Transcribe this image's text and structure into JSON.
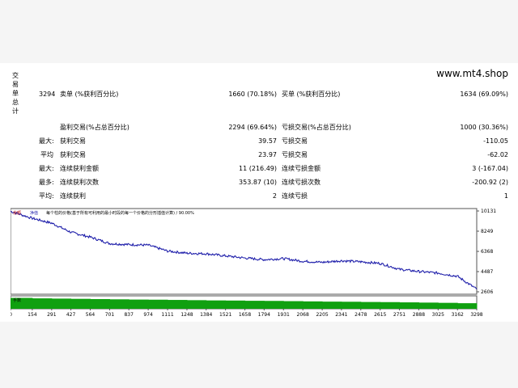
{
  "vertical_label": [
    "交",
    "易",
    "单",
    "总",
    "计"
  ],
  "site": "www.mt4.shop",
  "stats": {
    "total_trades": "3294",
    "short_label": "卖单 (%获利百分比)",
    "short_value": "1660 (70.18%)",
    "long_label": "买单 (%获利百分比)",
    "long_value": "1634 (69.09%)",
    "profit_trades_label": "盈利交易(%占总百分比)",
    "profit_trades_value": "2294 (69.64%)",
    "loss_trades_label": "亏损交易(%占总百分比)",
    "loss_trades_value": "1000 (30.36%)",
    "rows": [
      {
        "prefix": "最大:",
        "l1": "获利交易",
        "v1": "39.57",
        "l2": "亏损交易",
        "v2": "-110.05"
      },
      {
        "prefix": "平均",
        "l1": "获利交易",
        "v1": "23.97",
        "l2": "亏损交易",
        "v2": "-62.02"
      },
      {
        "prefix": "最大:",
        "l1": "连续获利金额",
        "v1": "11 (216.49)",
        "l2": "连续亏损金额",
        "v2": "3 (-167.04)"
      },
      {
        "prefix": "最多:",
        "l1": "连续获利次数",
        "v1": "353.87 (10)",
        "l2": "连续亏损次数",
        "v2": "-200.92 (2)"
      },
      {
        "prefix": "平均:",
        "l1": "连续获利",
        "v1": "2",
        "l2": "连续亏损",
        "v2": "1"
      }
    ]
  },
  "chart_data": {
    "type": "line",
    "legend": {
      "balance": "余额",
      "equity": "净值",
      "note": "每个柱的价格(基于所有可利用的最小时段的每一个价格的分形插值计算) / 90.00%"
    },
    "volume_label": "手数",
    "x_ticks": [
      "0",
      "154",
      "291",
      "427",
      "564",
      "701",
      "837",
      "974",
      "1111",
      "1248",
      "1384",
      "1521",
      "1658",
      "1794",
      "1931",
      "2068",
      "2205",
      "2341",
      "2478",
      "2615",
      "2751",
      "2888",
      "3025",
      "3162",
      "3298"
    ],
    "y_ticks": [
      10131,
      8249,
      6368,
      4487,
      2606
    ],
    "x": [
      0,
      154,
      291,
      427,
      564,
      701,
      837,
      974,
      1111,
      1248,
      1384,
      1521,
      1658,
      1794,
      1931,
      2068,
      2205,
      2341,
      2478,
      2615,
      2751,
      2888,
      3025,
      3162,
      3298
    ],
    "values": [
      10100,
      9450,
      9000,
      8150,
      7700,
      7100,
      7000,
      6950,
      6400,
      6200,
      6150,
      5950,
      5750,
      5600,
      5700,
      5450,
      5350,
      5500,
      5400,
      5250,
      4700,
      4500,
      4350,
      4050,
      2850
    ],
    "volume": [
      9,
      8.6,
      8.4,
      8.2,
      8.0,
      7.8,
      7.6,
      7.5,
      7.3,
      7.1,
      6.9,
      6.8,
      6.6,
      6.5,
      6.3,
      6.1,
      5.9,
      5.8,
      5.6,
      5.5,
      5.3,
      5.1,
      4.9,
      4.6,
      4.3
    ],
    "colors": {
      "line": "#1e1eaa",
      "volume": "#10a010",
      "label_red": "#b00000",
      "label_blue": "#1e1eaa"
    }
  }
}
